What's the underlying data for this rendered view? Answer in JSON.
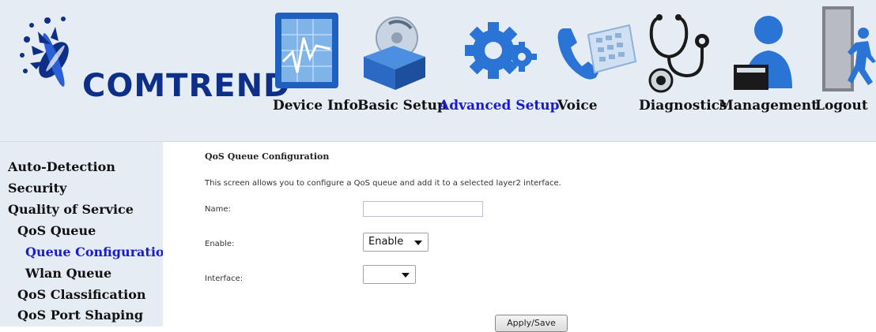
{
  "brand": {
    "logo_text": "COMTREND"
  },
  "nav": {
    "items": [
      {
        "label": "Device Info",
        "icon": "device-info-chart-icon",
        "active": false
      },
      {
        "label": "Basic Setup",
        "icon": "basic-setup-box-disc-icon",
        "active": false
      },
      {
        "label": "Advanced Setup",
        "icon": "advanced-setup-gears-icon",
        "active": true
      },
      {
        "label": "Voice",
        "icon": "voice-phone-icon",
        "active": false
      },
      {
        "label": "Diagnostics",
        "icon": "diagnostics-stethoscope-icon",
        "active": false
      },
      {
        "label": "Management",
        "icon": "management-user-icon",
        "active": false
      },
      {
        "label": "Logout",
        "icon": "logout-door-runner-icon",
        "active": false
      }
    ]
  },
  "sidebar": {
    "items": [
      {
        "label": "Auto-Detection",
        "active": false
      },
      {
        "label": "Security",
        "active": false
      },
      {
        "label": "Quality of Service",
        "active": false
      },
      {
        "label": "QoS Queue",
        "active": false
      },
      {
        "label": "Queue Configuration",
        "active": true
      },
      {
        "label": "Wlan Queue",
        "active": false
      },
      {
        "label": "QoS Classification",
        "active": false
      },
      {
        "label": "QoS Port Shaping",
        "active": false
      }
    ]
  },
  "main": {
    "title": "QoS Queue Configuration",
    "description": "This screen allows you to configure a QoS queue and add it to a selected layer2 interface.",
    "fields": {
      "name_label": "Name:",
      "name_value": "",
      "enable_label": "Enable:",
      "enable_value": "Enable",
      "interface_label": "Interface:",
      "interface_value": ""
    },
    "apply_label": "Apply/Save"
  },
  "colors": {
    "accent": "#1a1ad0",
    "header_bg": "#e6ecf4",
    "logo_blue": "#0d2f87"
  }
}
